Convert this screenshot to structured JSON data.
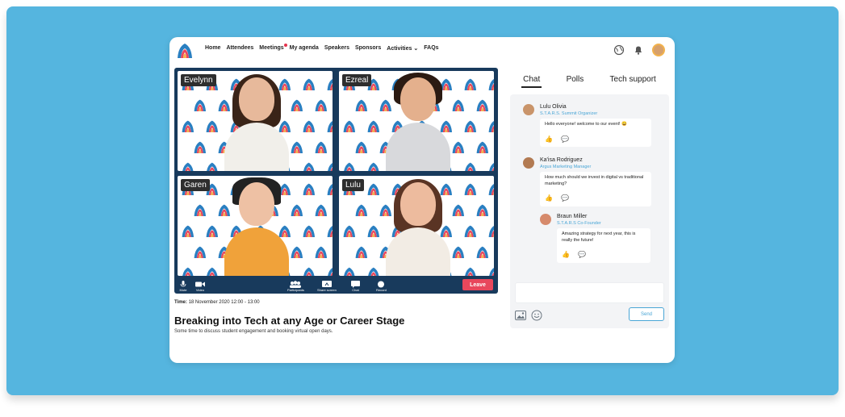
{
  "colors": {
    "background": "#55b5df",
    "video_bg": "#183a5c",
    "leave": "#e8475c",
    "accent": "#4aa6d6"
  },
  "nav": {
    "items": [
      "Home",
      "Attendees",
      "Meetings",
      "My agenda",
      "Speakers",
      "Sponsors",
      "Activities",
      "FAQs"
    ],
    "meetings_notification": true,
    "activities_has_dropdown": true,
    "icons": [
      "globe-icon",
      "bell-icon",
      "avatar"
    ]
  },
  "video": {
    "participants": [
      {
        "name": "Evelynn"
      },
      {
        "name": "Ezreal"
      },
      {
        "name": "Garen"
      },
      {
        "name": "Lulu"
      }
    ],
    "controls": {
      "mute": "Mute",
      "video": "Video",
      "participants": "Participants",
      "share_screen": "Share screen",
      "chat": "Chat",
      "record": "Record",
      "leave": "Leave"
    }
  },
  "session": {
    "time_label": "Time:",
    "time_value": "18 November 2020 12:00 - 13:00",
    "title": "Breaking into Tech at any Age or Career Stage",
    "description": "Some time to discuss student engagement and booking virtual open days."
  },
  "sidebar": {
    "tabs": [
      "Chat",
      "Polls",
      "Tech support"
    ],
    "active_tab": "Chat",
    "messages": [
      {
        "name": "Lulu Olivia",
        "role": "S.T.A.R.S. Summit Organizer",
        "text": "Hello everyone! welcome to our event! 😀"
      },
      {
        "name": "Ka'isa Rodriguez",
        "role": "Argus Marketing Manager",
        "text": "How much should we invest in digital vs traditional marketing?"
      },
      {
        "name": "Braun Miller",
        "role": "S.T.A.R.S Co-Founder",
        "text": "Amazing strategy for next year, this is really the future!"
      }
    ],
    "send_label": "Send"
  }
}
